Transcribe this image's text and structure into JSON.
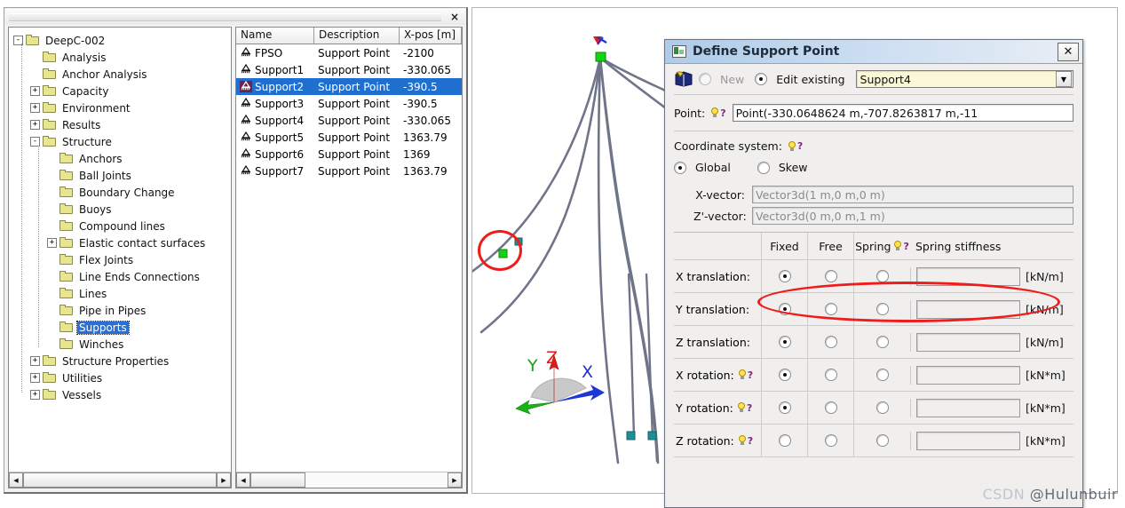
{
  "window": {
    "close_label": "×"
  },
  "tree": {
    "root": "DeepC-002",
    "items": [
      {
        "label": "DeepC-002",
        "depth": 0,
        "toggle": "-",
        "selected": false
      },
      {
        "label": "Analysis",
        "depth": 1,
        "toggle": "",
        "selected": false
      },
      {
        "label": "Anchor Analysis",
        "depth": 1,
        "toggle": "",
        "selected": false
      },
      {
        "label": "Capacity",
        "depth": 1,
        "toggle": "+",
        "selected": false
      },
      {
        "label": "Environment",
        "depth": 1,
        "toggle": "+",
        "selected": false
      },
      {
        "label": "Results",
        "depth": 1,
        "toggle": "+",
        "selected": false
      },
      {
        "label": "Structure",
        "depth": 1,
        "toggle": "-",
        "selected": false
      },
      {
        "label": "Anchors",
        "depth": 2,
        "toggle": "",
        "selected": false
      },
      {
        "label": "Ball Joints",
        "depth": 2,
        "toggle": "",
        "selected": false
      },
      {
        "label": "Boundary Change",
        "depth": 2,
        "toggle": "",
        "selected": false
      },
      {
        "label": "Buoys",
        "depth": 2,
        "toggle": "",
        "selected": false
      },
      {
        "label": "Compound lines",
        "depth": 2,
        "toggle": "",
        "selected": false
      },
      {
        "label": "Elastic contact surfaces",
        "depth": 2,
        "toggle": "+",
        "selected": false
      },
      {
        "label": "Flex Joints",
        "depth": 2,
        "toggle": "",
        "selected": false
      },
      {
        "label": "Line Ends Connections",
        "depth": 2,
        "toggle": "",
        "selected": false
      },
      {
        "label": "Lines",
        "depth": 2,
        "toggle": "",
        "selected": false
      },
      {
        "label": "Pipe in Pipes",
        "depth": 2,
        "toggle": "",
        "selected": false
      },
      {
        "label": "Supports",
        "depth": 2,
        "toggle": "",
        "selected": true
      },
      {
        "label": "Winches",
        "depth": 2,
        "toggle": "",
        "selected": false
      },
      {
        "label": "Structure Properties",
        "depth": 1,
        "toggle": "+",
        "selected": false
      },
      {
        "label": "Utilities",
        "depth": 1,
        "toggle": "+",
        "selected": false
      },
      {
        "label": "Vessels",
        "depth": 1,
        "toggle": "+",
        "selected": false
      }
    ]
  },
  "list": {
    "columns": [
      "Name",
      "Description",
      "X-pos [m]"
    ],
    "rows": [
      {
        "name": "FPSO",
        "description": "Support Point",
        "xpos": "-2100",
        "selected": false
      },
      {
        "name": "Support1",
        "description": "Support Point",
        "xpos": "-330.065",
        "selected": false
      },
      {
        "name": "Support2",
        "description": "Support Point",
        "xpos": "-390.5",
        "selected": true
      },
      {
        "name": "Support3",
        "description": "Support Point",
        "xpos": "-390.5",
        "selected": false
      },
      {
        "name": "Support4",
        "description": "Support Point",
        "xpos": "-330.065",
        "selected": false
      },
      {
        "name": "Support5",
        "description": "Support Point",
        "xpos": "1363.79",
        "selected": false
      },
      {
        "name": "Support6",
        "description": "Support Point",
        "xpos": "1369",
        "selected": false
      },
      {
        "name": "Support7",
        "description": "Support Point",
        "xpos": "1363.79",
        "selected": false
      }
    ]
  },
  "viewport": {
    "axis_labels": {
      "x": "X",
      "y": "Y",
      "z": "Z"
    }
  },
  "dialog": {
    "title": "Define Support Point",
    "close_label": "✕",
    "mode": {
      "new_label": "New",
      "edit_label": "Edit existing",
      "selected": "edit",
      "combo_value": "Support4",
      "combo_arrow": "▼"
    },
    "point": {
      "label": "Point:",
      "value": "Point(-330.0648624 m,-707.8263817 m,-11"
    },
    "coordinate_system": {
      "label": "Coordinate system:",
      "global_label": "Global",
      "skew_label": "Skew",
      "selected": "global",
      "x_vector_label": "X-vector:",
      "x_vector_value": "Vector3d(1 m,0 m,0 m)",
      "z_vector_label": "Z'-vector:",
      "z_vector_value": "Vector3d(0 m,0 m,1 m)"
    },
    "constraints": {
      "headers": {
        "fixed": "Fixed",
        "free": "Free",
        "spring": "Spring",
        "stiffness": "Spring stiffness"
      },
      "rows": [
        {
          "label": "X translation:",
          "hint": false,
          "selected": "fixed",
          "stiffness": "",
          "unit": "[kN/m]"
        },
        {
          "label": "Y translation:",
          "hint": false,
          "selected": "fixed",
          "stiffness": "",
          "unit": "[kN/m]"
        },
        {
          "label": "Z translation:",
          "hint": false,
          "selected": "fixed",
          "stiffness": "",
          "unit": "[kN/m]"
        },
        {
          "label": "X rotation:",
          "hint": true,
          "selected": "fixed",
          "stiffness": "",
          "unit": "[kN*m]"
        },
        {
          "label": "Y rotation:",
          "hint": true,
          "selected": "fixed",
          "stiffness": "",
          "unit": "[kN*m]"
        },
        {
          "label": "Z rotation:",
          "hint": true,
          "selected": "none",
          "stiffness": "",
          "unit": "[kN*m]"
        }
      ]
    }
  },
  "watermark": {
    "prefix": "CSDN ",
    "handle": "@Hulunbuir"
  }
}
